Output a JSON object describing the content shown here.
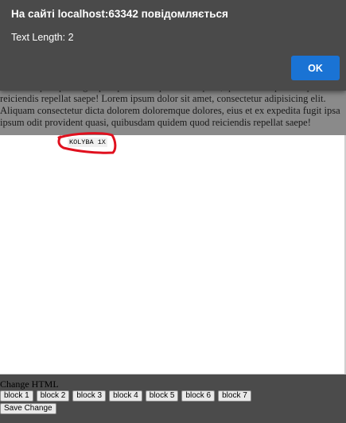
{
  "dialog": {
    "title": "На сайті localhost:63342 повідомляється",
    "message": "Text Length: 2",
    "ok_label": "OK"
  },
  "page": {
    "lorem_text": "Sit dolor quis ipsa fugit ipsa ipsum odit provident quasi, quibusdam quidem quod reiciendis repellat saepe! Lorem ipsum dolor sit amet, consectetur adipisicing elit. Aliquam consectetur dicta dolorem doloremque dolores, eius et ex expedita fugit ipsa ipsum odit provident quasi, quibusdam quidem quod reiciendis repellat saepe!",
    "kolyba_tag": "KOLYBA 1X"
  },
  "controls": {
    "change_label": "Change HTML",
    "blocks": [
      "block 1",
      "block 2",
      "block 3",
      "block 4",
      "block 5",
      "block 6",
      "block 7"
    ],
    "save_label": "Save Change"
  },
  "colors": {
    "dialog_bg": "#4a4a4a",
    "ok_button": "#1a73d4",
    "annotation": "#e0101e"
  }
}
